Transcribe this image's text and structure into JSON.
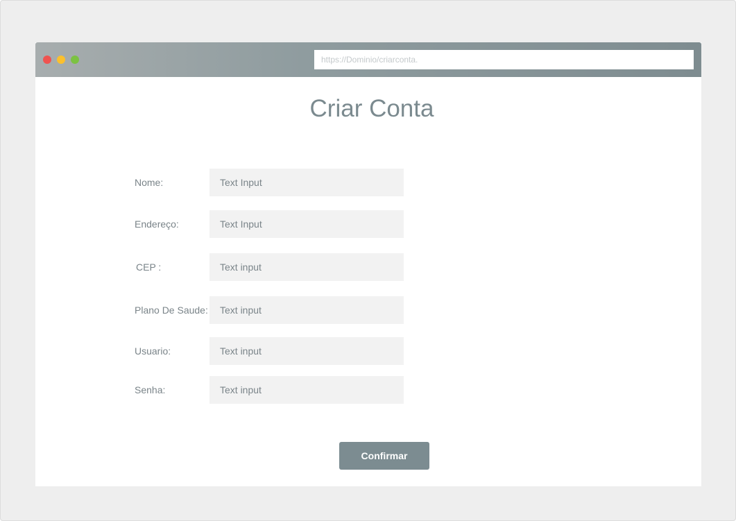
{
  "browser": {
    "url_placeholder": "https://Dominio/criarconta.",
    "window_buttons": [
      "close-dot",
      "minimize-dot",
      "maximize-dot"
    ]
  },
  "page": {
    "title": "Criar Conta"
  },
  "form": {
    "fields": [
      {
        "label": "Nome:",
        "placeholder": "Text Input"
      },
      {
        "label": "Endereço:",
        "placeholder": "Text Input"
      },
      {
        "label": "CEP :",
        "placeholder": "Text input"
      },
      {
        "label": "Plano De Saude:",
        "placeholder": "Text input"
      },
      {
        "label": "Usuario:",
        "placeholder": "Text input"
      },
      {
        "label": "Senha:",
        "placeholder": "Text input"
      }
    ],
    "confirm_label": "Confirmar"
  },
  "colors": {
    "dot_close": "#ef5350",
    "dot_minimize": "#fbc02d",
    "dot_maximize": "#7cc242",
    "accent": "#7c8c91",
    "input_bg": "#f2f2f2"
  }
}
